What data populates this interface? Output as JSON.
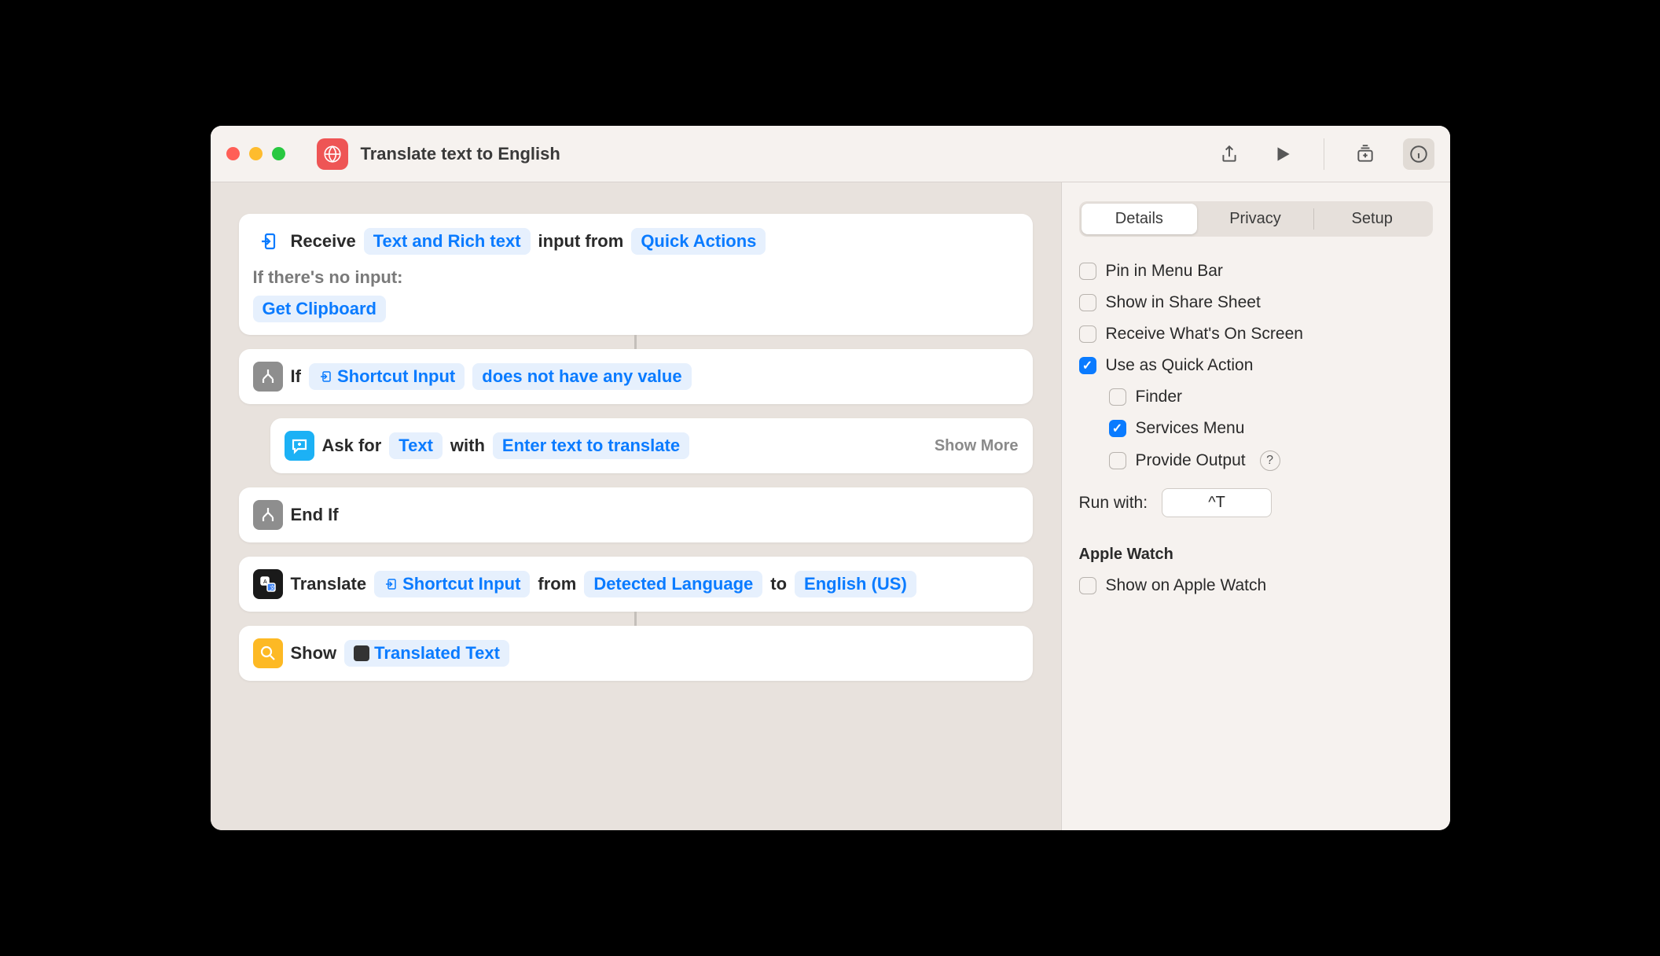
{
  "window": {
    "title": "Translate text to English"
  },
  "actions": {
    "receive": {
      "label_receive": "Receive",
      "types": "Text and Rich text",
      "label_input_from": "input from",
      "source": "Quick Actions",
      "no_input_label": "If there's no input:",
      "fallback": "Get Clipboard"
    },
    "if": {
      "label": "If",
      "var": "Shortcut Input",
      "condition": "does not have any value"
    },
    "ask": {
      "label_ask_for": "Ask for",
      "type": "Text",
      "label_with": "with",
      "prompt": "Enter text to translate",
      "show_more": "Show More"
    },
    "endif": {
      "label": "End If"
    },
    "translate": {
      "label": "Translate",
      "var": "Shortcut Input",
      "label_from": "from",
      "from_lang": "Detected Language",
      "label_to": "to",
      "to_lang": "English (US)"
    },
    "show": {
      "label": "Show",
      "var": "Translated Text"
    }
  },
  "sidebar": {
    "tabs": {
      "details": "Details",
      "privacy": "Privacy",
      "setup": "Setup"
    },
    "options": {
      "pin_menu_bar": {
        "label": "Pin in Menu Bar",
        "checked": false
      },
      "show_share_sheet": {
        "label": "Show in Share Sheet",
        "checked": false
      },
      "receive_screen": {
        "label": "Receive What's On Screen",
        "checked": false
      },
      "quick_action": {
        "label": "Use as Quick Action",
        "checked": true
      },
      "finder": {
        "label": "Finder",
        "checked": false
      },
      "services_menu": {
        "label": "Services Menu",
        "checked": true
      },
      "provide_output": {
        "label": "Provide Output",
        "checked": false
      }
    },
    "run_with": {
      "label": "Run with:",
      "value": "^T"
    },
    "apple_watch": {
      "heading": "Apple Watch",
      "show": {
        "label": "Show on Apple Watch",
        "checked": false
      }
    }
  }
}
